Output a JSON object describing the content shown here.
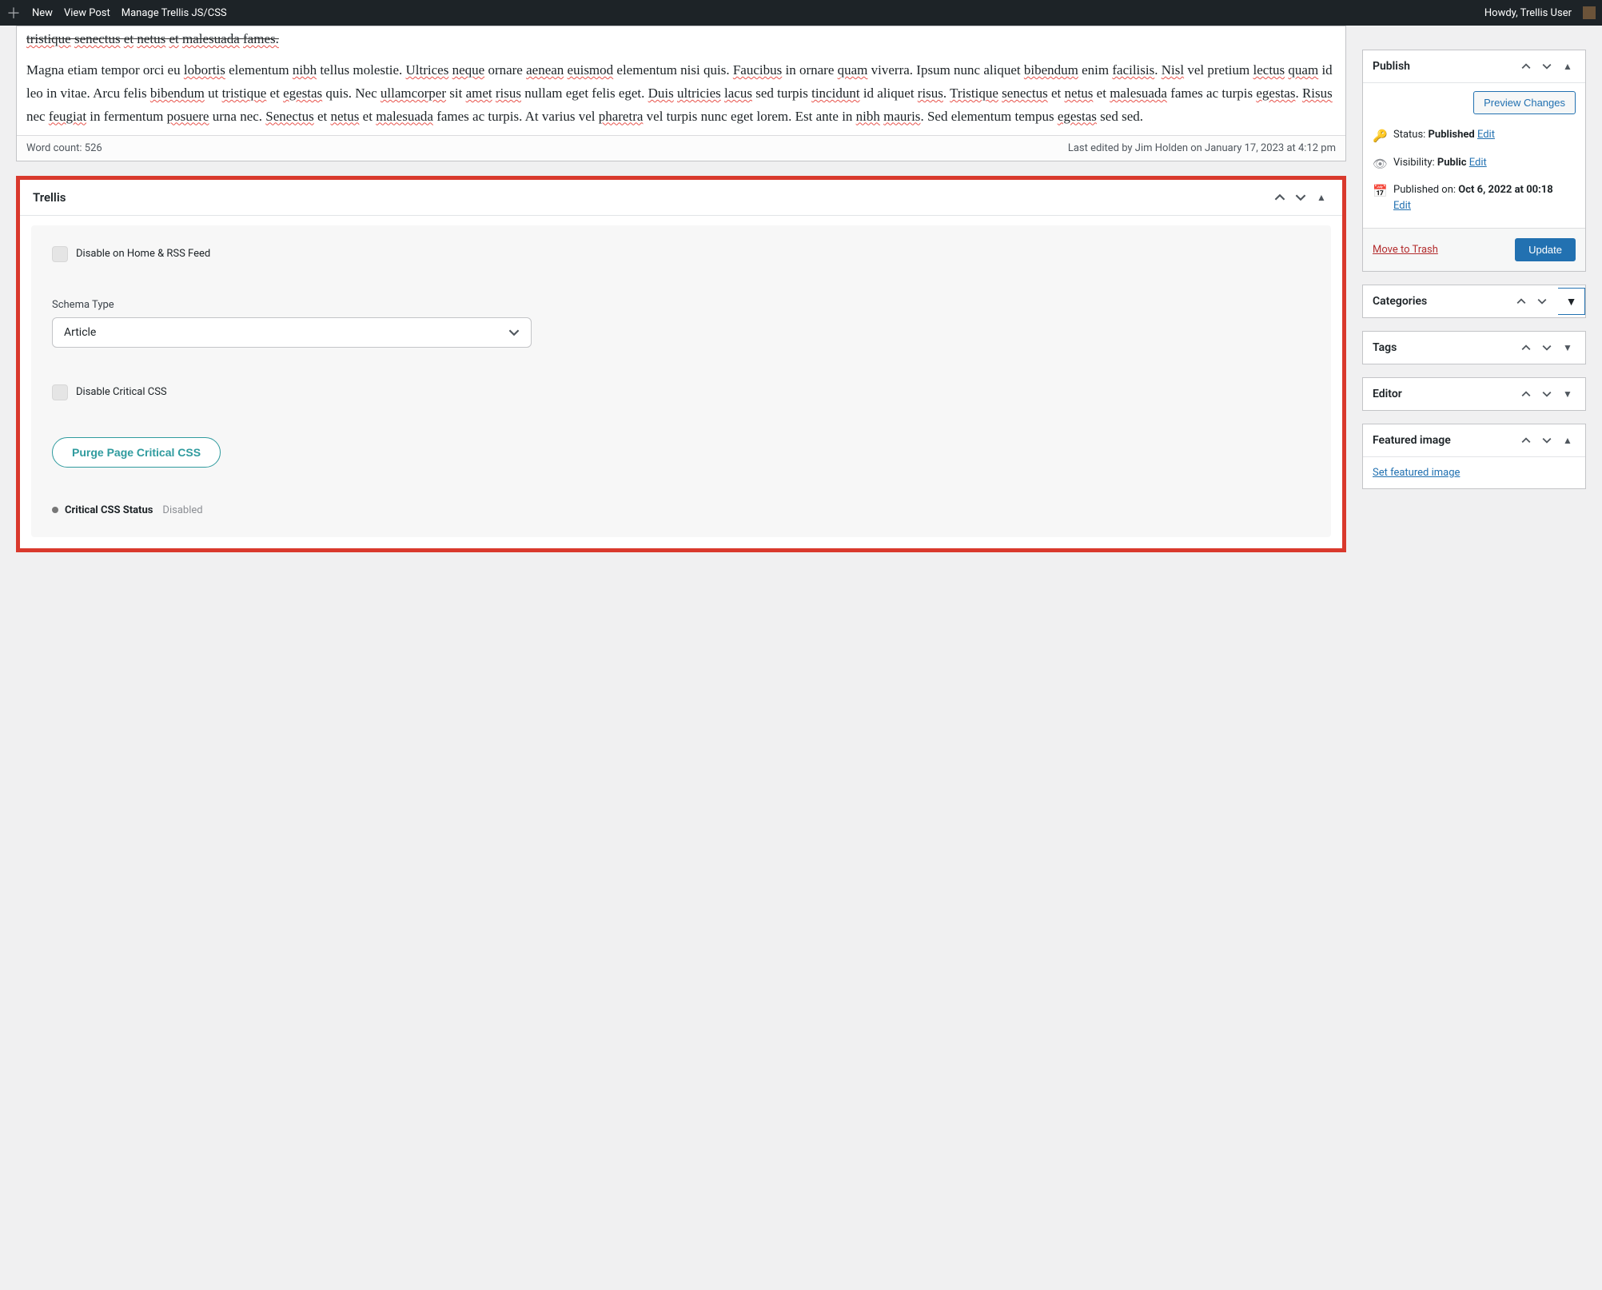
{
  "adminbar": {
    "new": "New",
    "view_post": "View Post",
    "manage_trellis": "Manage Trellis JS/CSS",
    "howdy": "Howdy, Trellis User"
  },
  "editor": {
    "truncated_line": "tristique senectus et netus et malesuada fames.",
    "paragraph_parts": [
      {
        "t": "Magna etiam tempor orci eu ",
        "w": false
      },
      {
        "t": "lobortis",
        "w": true
      },
      {
        "t": " elementum ",
        "w": false
      },
      {
        "t": "nibh",
        "w": true
      },
      {
        "t": " tellus molestie. ",
        "w": false
      },
      {
        "t": "Ultrices",
        "w": true
      },
      {
        "t": " ",
        "w": false
      },
      {
        "t": "neque",
        "w": true
      },
      {
        "t": " ornare ",
        "w": false
      },
      {
        "t": "aenean",
        "w": true
      },
      {
        "t": " ",
        "w": false
      },
      {
        "t": "euismod",
        "w": true
      },
      {
        "t": " elementum nisi quis. ",
        "w": false
      },
      {
        "t": "Faucibus",
        "w": true
      },
      {
        "t": " in ornare ",
        "w": false
      },
      {
        "t": "quam",
        "w": true
      },
      {
        "t": " viverra. Ipsum nunc aliquet ",
        "w": false
      },
      {
        "t": "bibendum",
        "w": true
      },
      {
        "t": " enim ",
        "w": false
      },
      {
        "t": "facilisis",
        "w": true
      },
      {
        "t": ". ",
        "w": false
      },
      {
        "t": "Nisl",
        "w": true
      },
      {
        "t": " vel pretium ",
        "w": false
      },
      {
        "t": "lectus",
        "w": true
      },
      {
        "t": " ",
        "w": false
      },
      {
        "t": "quam",
        "w": true
      },
      {
        "t": " id leo in vitae. Arcu felis ",
        "w": false
      },
      {
        "t": "bibendum",
        "w": true
      },
      {
        "t": " ut ",
        "w": false
      },
      {
        "t": "tristique",
        "w": true
      },
      {
        "t": " et ",
        "w": false
      },
      {
        "t": "egestas",
        "w": true
      },
      {
        "t": " quis. Nec ",
        "w": false
      },
      {
        "t": "ullamcorper",
        "w": true
      },
      {
        "t": " sit ",
        "w": false
      },
      {
        "t": "amet",
        "w": true
      },
      {
        "t": " ",
        "w": false
      },
      {
        "t": "risus",
        "w": true
      },
      {
        "t": " nullam eget felis eget. ",
        "w": false
      },
      {
        "t": "Duis",
        "w": true
      },
      {
        "t": " ",
        "w": false
      },
      {
        "t": "ultricies",
        "w": true
      },
      {
        "t": " ",
        "w": false
      },
      {
        "t": "lacus",
        "w": true
      },
      {
        "t": " sed turpis ",
        "w": false
      },
      {
        "t": "tincidunt",
        "w": true
      },
      {
        "t": " id aliquet ",
        "w": false
      },
      {
        "t": "risus",
        "w": true
      },
      {
        "t": ". ",
        "w": false
      },
      {
        "t": "Tristique",
        "w": true
      },
      {
        "t": " ",
        "w": false
      },
      {
        "t": "senectus",
        "w": true
      },
      {
        "t": " et ",
        "w": false
      },
      {
        "t": "netus",
        "w": true
      },
      {
        "t": " et ",
        "w": false
      },
      {
        "t": "malesuada",
        "w": true
      },
      {
        "t": " fames ac turpis ",
        "w": false
      },
      {
        "t": "egestas",
        "w": true
      },
      {
        "t": ". ",
        "w": false
      },
      {
        "t": "Risus",
        "w": true
      },
      {
        "t": " nec ",
        "w": false
      },
      {
        "t": "feugiat",
        "w": true
      },
      {
        "t": " in fermentum ",
        "w": false
      },
      {
        "t": "posuere",
        "w": true
      },
      {
        "t": " urna nec. ",
        "w": false
      },
      {
        "t": "Senectus",
        "w": true
      },
      {
        "t": " et ",
        "w": false
      },
      {
        "t": "netus",
        "w": true
      },
      {
        "t": " et ",
        "w": false
      },
      {
        "t": "malesuada",
        "w": true
      },
      {
        "t": " fames ac turpis. At varius vel ",
        "w": false
      },
      {
        "t": "pharetra",
        "w": true
      },
      {
        "t": " vel turpis nunc eget lorem. Est ante in ",
        "w": false
      },
      {
        "t": "nibh",
        "w": true
      },
      {
        "t": " ",
        "w": false
      },
      {
        "t": "mauris",
        "w": true
      },
      {
        "t": ". Sed elementum tempus ",
        "w": false
      },
      {
        "t": "egestas",
        "w": true
      },
      {
        "t": " sed sed.",
        "w": false
      }
    ],
    "word_count": "Word count: 526",
    "last_edited": "Last edited by Jim Holden on January 17, 2023 at 4:12 pm"
  },
  "trellis": {
    "title": "Trellis",
    "disable_home": "Disable on Home & RSS Feed",
    "schema_label": "Schema Type",
    "schema_value": "Article",
    "disable_css": "Disable Critical CSS",
    "purge_btn": "Purge Page Critical CSS",
    "status_label": "Critical CSS Status",
    "status_value": "Disabled"
  },
  "publish": {
    "title": "Publish",
    "preview_btn": "Preview Changes",
    "status_label": "Status: ",
    "status_value": "Published",
    "edit": "Edit",
    "visibility_label": "Visibility: ",
    "visibility_value": "Public",
    "published_label": "Published on: ",
    "published_value": "Oct 6, 2022 at 00:18",
    "trash": "Move to Trash",
    "update": "Update"
  },
  "panels": {
    "categories": "Categories",
    "tags": "Tags",
    "editor": "Editor",
    "featured": "Featured image",
    "set_featured": "Set featured image"
  }
}
